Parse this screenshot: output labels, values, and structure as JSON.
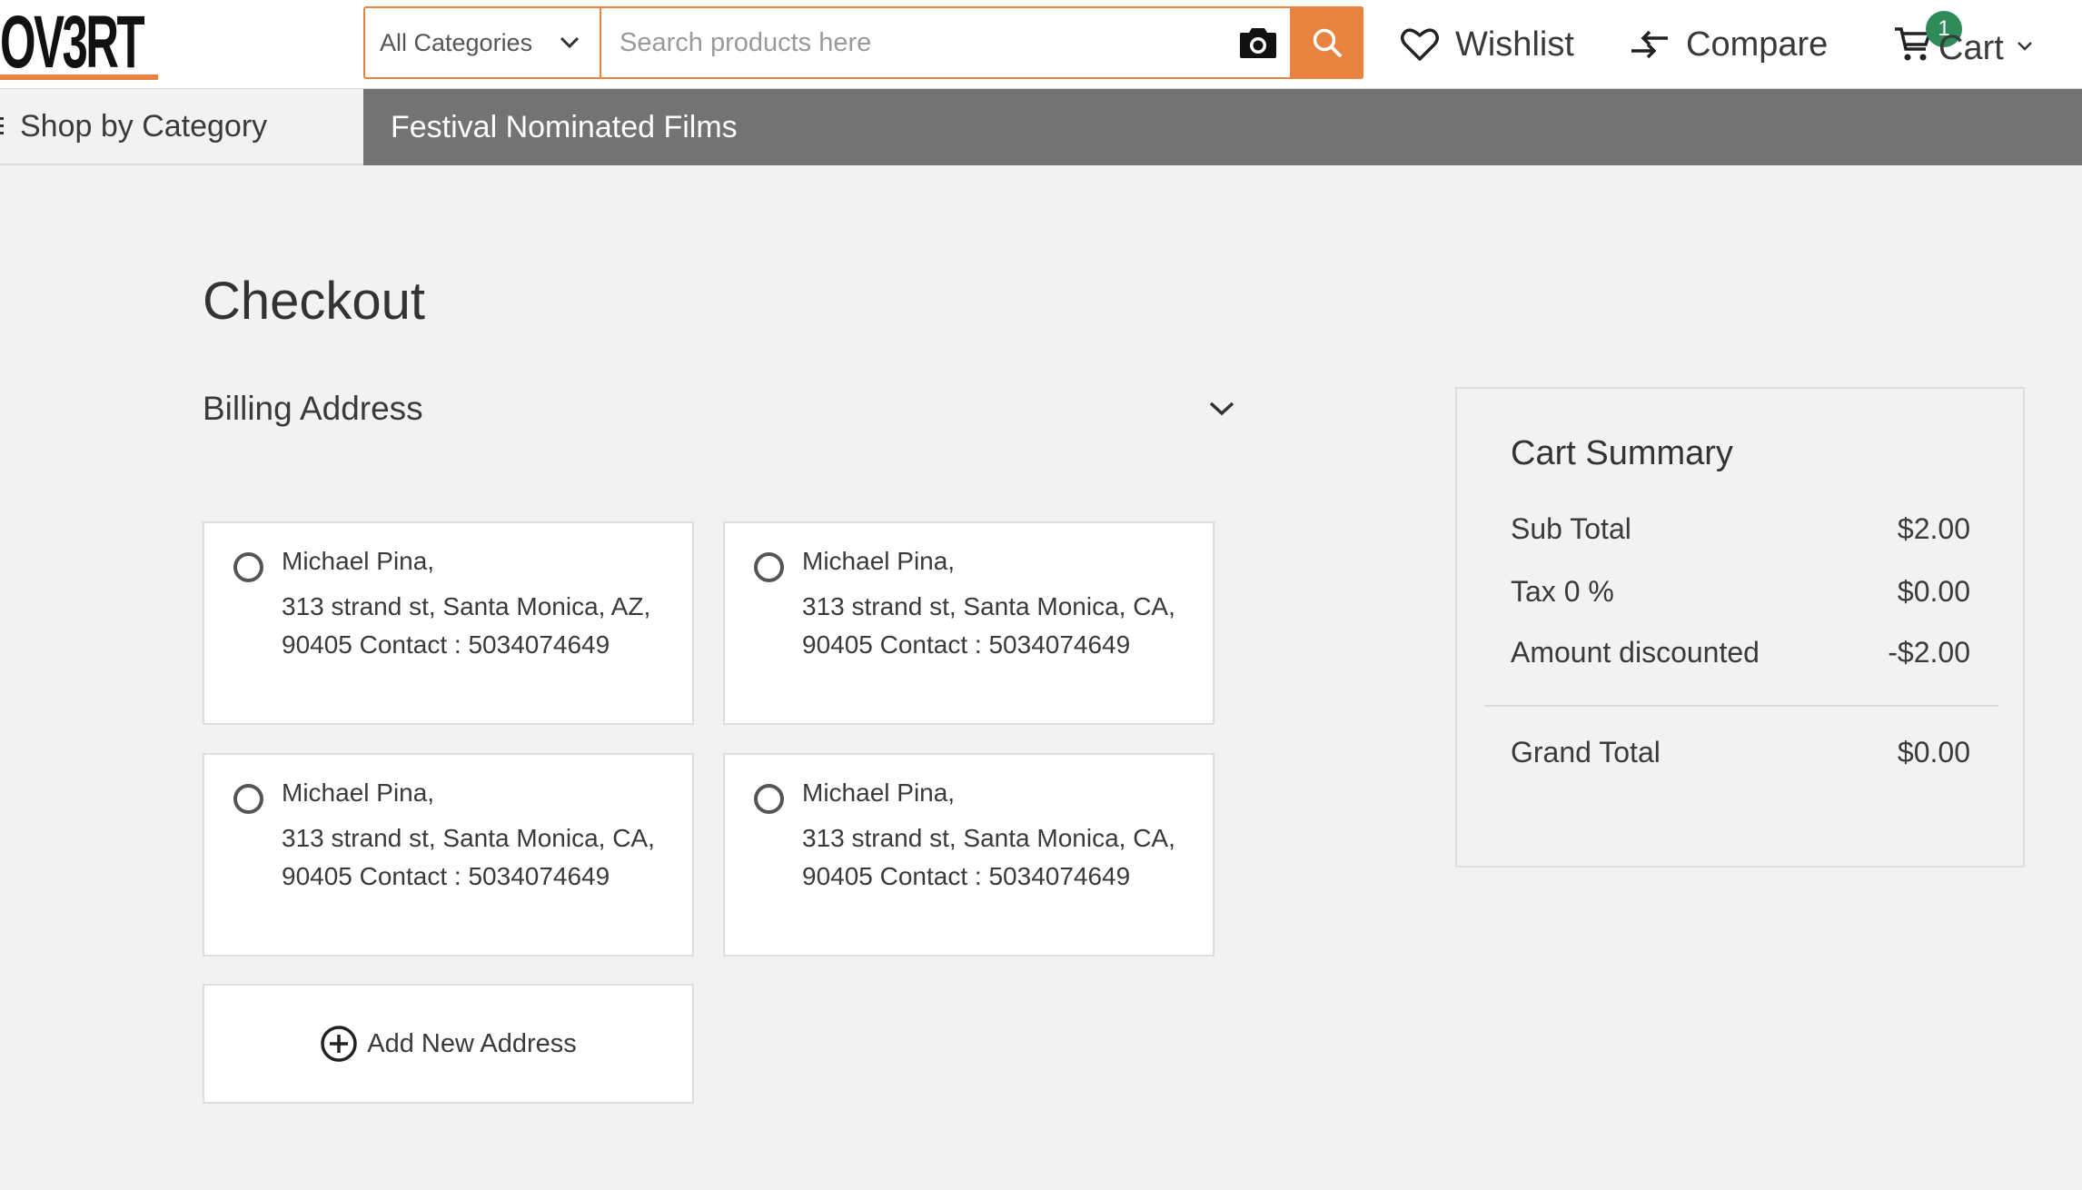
{
  "brand": {
    "logo_text": "OV3RT"
  },
  "colors": {
    "accent": "#e8843f",
    "nav_bg": "#737373",
    "badge": "#2e8b57",
    "page_bg": "#f2f2f2"
  },
  "header": {
    "category_select": {
      "selected": "All Categories",
      "icon": "chevron-down-icon"
    },
    "search": {
      "placeholder": "Search products here",
      "value": ""
    },
    "actions": {
      "wishlist": {
        "label": "Wishlist",
        "icon": "heart-icon"
      },
      "compare": {
        "label": "Compare",
        "icon": "compare-arrows-icon"
      },
      "cart": {
        "label": "Cart",
        "icon": "cart-icon",
        "count": "1"
      }
    }
  },
  "nav": {
    "shop_by_category": "Shop by Category",
    "links": [
      "Festival Nominated Films"
    ]
  },
  "checkout": {
    "title": "Checkout",
    "billing": {
      "title": "Billing Address",
      "addresses": [
        {
          "name": "Michael Pina,",
          "line1": "313 strand st, Santa Monica, AZ,",
          "line2": "90405 Contact : 5034074649"
        },
        {
          "name": "Michael Pina,",
          "line1": "313 strand st, Santa Monica, CA,",
          "line2": "90405 Contact : 5034074649"
        },
        {
          "name": "Michael Pina,",
          "line1": "313 strand st, Santa Monica, CA,",
          "line2": "90405 Contact : 5034074649"
        },
        {
          "name": "Michael Pina,",
          "line1": "313 strand st, Santa Monica, CA,",
          "line2": "90405 Contact : 5034074649"
        }
      ],
      "add_new": "Add New Address"
    }
  },
  "cart_summary": {
    "title": "Cart Summary",
    "rows": [
      {
        "label": "Sub Total",
        "value": "$2.00"
      },
      {
        "label": "Tax 0 %",
        "value": "$0.00"
      },
      {
        "label": "Amount discounted",
        "value": "-$2.00"
      }
    ],
    "grand_total": {
      "label": "Grand Total",
      "value": "$0.00"
    }
  }
}
